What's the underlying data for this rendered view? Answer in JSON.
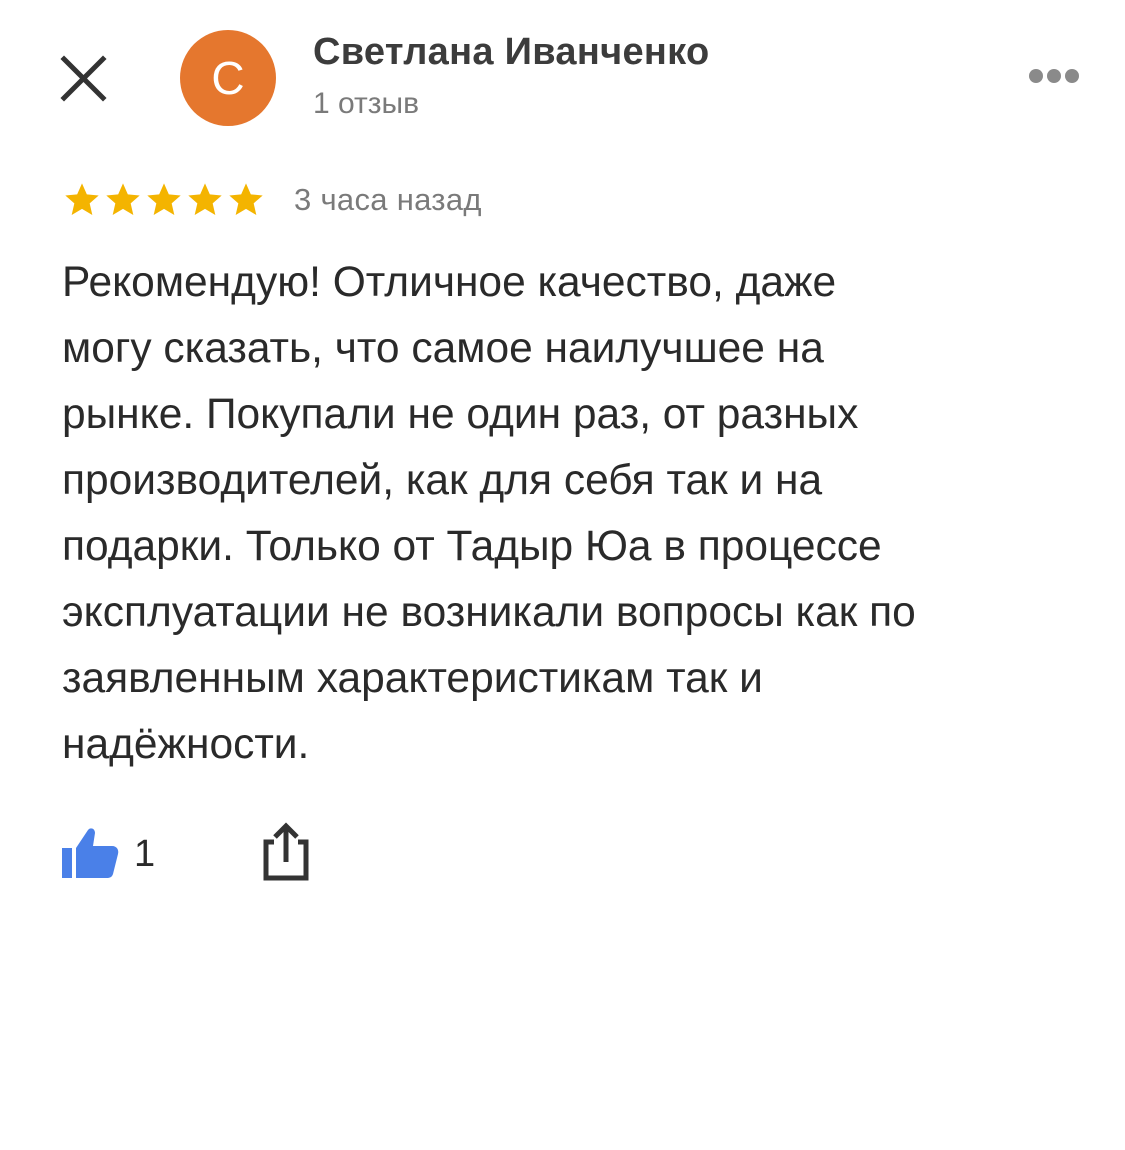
{
  "header": {
    "close_icon": "close-icon",
    "more_icon": "more-horizontal-icon",
    "author": {
      "initial": "С",
      "name": "Светлана Иванченко",
      "reviews": "1 отзыв",
      "avatar_color": "#E5772E"
    }
  },
  "review": {
    "rating": 5,
    "rating_max": 5,
    "star_color": "#F4B400",
    "time": "3 часа назад",
    "text_lines": [
      "Рекомендую! Отличное качество, даже",
      "могу сказать, что самое наилучшее на",
      "рынке. Покупали не один раз, от разных",
      "производителей, как для себя так и на",
      "подарки. Только от Тадыр Юа в процессе",
      "эксплуатации не возникали вопросы как по",
      "заявленным характеристикам так и",
      "надёжности."
    ]
  },
  "actions": {
    "like_icon": "thumbs-up-icon",
    "like_color": "#4A80E8",
    "like_count": "1",
    "share_icon": "share-icon"
  }
}
